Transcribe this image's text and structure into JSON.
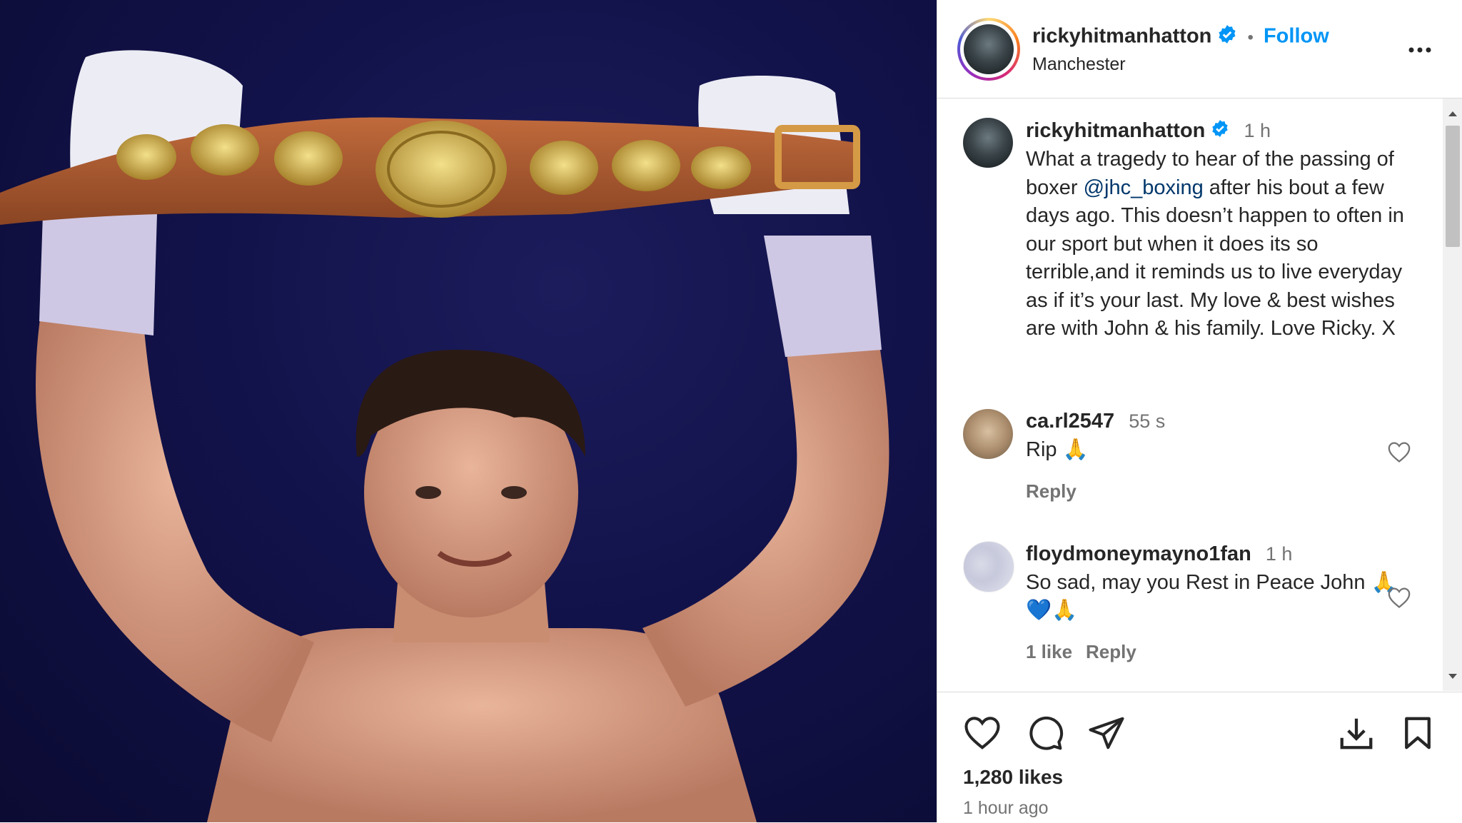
{
  "post": {
    "username": "rickyhitmanhatton",
    "follow_label": "Follow",
    "separator": "•",
    "location": "Manchester"
  },
  "caption": {
    "username": "rickyhitmanhatton",
    "time": "1 h",
    "text_before": "What a tragedy to hear of the passing of boxer ",
    "mention": "@jhc_boxing",
    "text_after": " after his bout a few days ago. This doesn’t happen to often in our sport but when it does its so terrible,and it reminds us to live everyday as if it’s your last. My love & best wishes are with John & his family. Love Ricky. X"
  },
  "comments": [
    {
      "username": "ca.rl2547",
      "time": "55 s",
      "text": "Rip 🙏",
      "reply_label": "Reply"
    },
    {
      "username": "floydmoneymayno1fan",
      "time": "1 h",
      "text": "So sad, may you Rest in Peace John 🙏💙🙏",
      "likes_label": "1 like",
      "reply_label": "Reply"
    }
  ],
  "footer": {
    "likes": "1,280 likes",
    "posted": "1 hour ago"
  },
  "icons": {
    "verified": "verified-badge-icon",
    "more": "more-options-icon",
    "like": "heart-icon",
    "comment": "comment-icon",
    "share": "send-icon",
    "download": "download-icon",
    "save": "bookmark-icon"
  },
  "colors": {
    "accent": "#0095f6",
    "verified": "#0095f6",
    "mention": "#00376b",
    "secondary_text": "#737373",
    "photo_background": "#12124a"
  }
}
